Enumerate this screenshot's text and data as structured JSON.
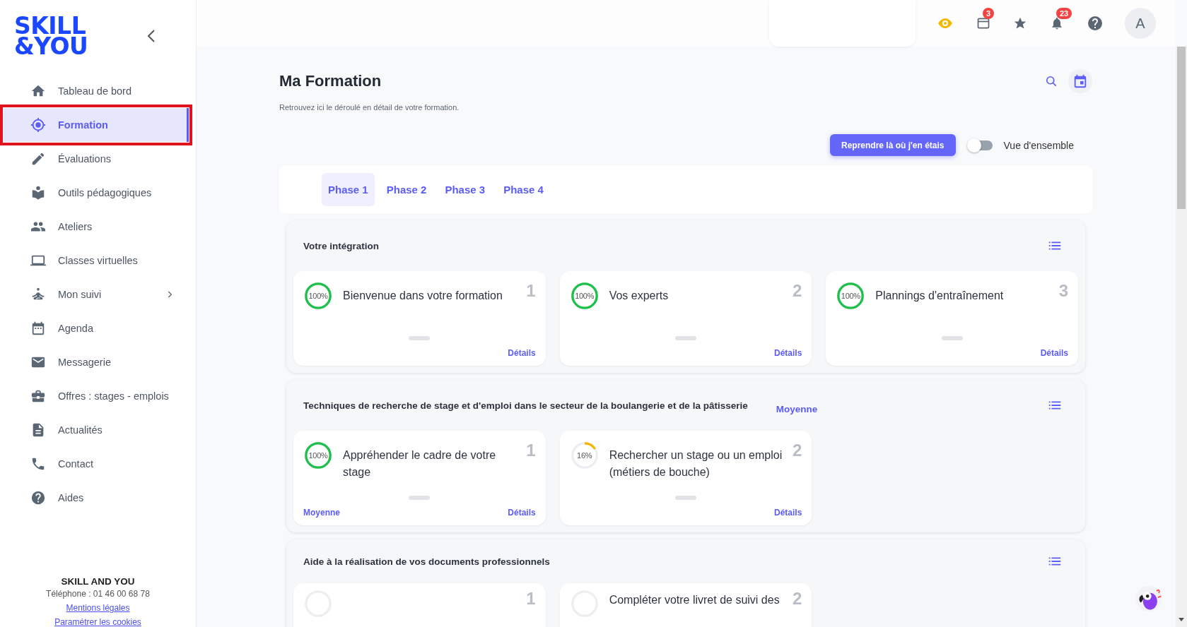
{
  "brand": {
    "line1": "SKILL",
    "line2": "&YOU"
  },
  "sidebar": {
    "items": [
      {
        "label": "Tableau de bord",
        "selected": false
      },
      {
        "label": "Formation",
        "selected": true
      },
      {
        "label": "Évaluations",
        "selected": false
      },
      {
        "label": "Outils pédagogiques",
        "selected": false
      },
      {
        "label": "Ateliers",
        "selected": false
      },
      {
        "label": "Classes virtuelles",
        "selected": false
      },
      {
        "label": "Mon suivi",
        "selected": false,
        "expandable": true
      },
      {
        "label": "Agenda",
        "selected": false
      },
      {
        "label": "Messagerie",
        "selected": false
      },
      {
        "label": "Offres : stages - emplois",
        "selected": false
      },
      {
        "label": "Actualités",
        "selected": false
      },
      {
        "label": "Contact",
        "selected": false
      },
      {
        "label": "Aides",
        "selected": false
      }
    ]
  },
  "sidebar_footer": {
    "company": "SKILL AND YOU",
    "phone": "Téléphone : 01 46 00 68 78",
    "links": [
      "Mentions légales",
      "Paramétrer les cookies"
    ]
  },
  "topbar": {
    "calendar_badge": "3",
    "bell_badge": "23",
    "avatar": "A"
  },
  "page": {
    "title": "Ma Formation",
    "subtitle": "Retrouvez ici le déroulé en détail de votre formation.",
    "resume_button": "Reprendre là où j'en étais",
    "overview_toggle": {
      "label": "Vue d'ensemble",
      "on": false
    }
  },
  "tabs": [
    {
      "label": "Phase 1",
      "selected": true
    },
    {
      "label": "Phase 2",
      "selected": false
    },
    {
      "label": "Phase 3",
      "selected": false
    },
    {
      "label": "Phase 4",
      "selected": false
    }
  ],
  "sections": [
    {
      "title": "Votre intégration",
      "cards": [
        {
          "number": "1",
          "title": "Bienvenue dans votre formation",
          "percent": "100%",
          "level": 1,
          "details": "Détails"
        },
        {
          "number": "2",
          "title": "Vos experts",
          "percent": "100%",
          "level": 1,
          "details": "Détails"
        },
        {
          "number": "3",
          "title": "Plannings d'entraînement",
          "percent": "100%",
          "level": 1,
          "details": "Détails"
        }
      ]
    },
    {
      "title": "Techniques de recherche de stage et d'emploi dans le secteur de la boulangerie et de la pâtisserie",
      "tag": "Moyenne",
      "cards": [
        {
          "number": "1",
          "title": "Appréhender le cadre de votre stage",
          "percent": "100%",
          "level": 1,
          "tag": "Moyenne",
          "details": "Détails"
        },
        {
          "number": "2",
          "title": "Rechercher un stage ou un emploi (métiers de bouche)",
          "percent": "16%",
          "level": 0.16,
          "details": "Détails"
        }
      ]
    },
    {
      "title": "Aide à la réalisation de vos documents professionnels",
      "cards": [
        {
          "number": "1"
        },
        {
          "number": "2",
          "title": "Compléter votre livret de suivi des"
        }
      ]
    }
  ]
}
